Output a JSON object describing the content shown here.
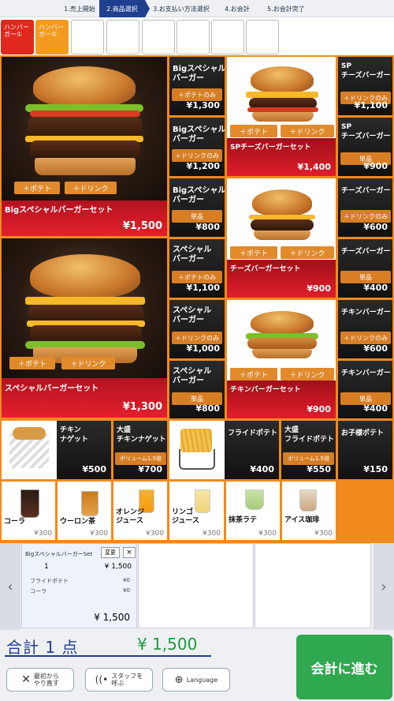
{
  "steps": [
    "1.売上開始",
    "2.商品選択",
    "3.お支払い方法選択",
    "4.お会計",
    "5.お会計完了"
  ],
  "tabs": [
    {
      "label": "ハンバーガー①"
    },
    {
      "label": "ハンバーガー②"
    }
  ],
  "set_buttons": {
    "potato": "＋ポテト",
    "drink": "＋ドリンク",
    "potato_only": "＋ポテトのみ",
    "drink_only": "＋ドリンクのみ",
    "single": "単品",
    "volume": "ボリューム1.5倍"
  },
  "sets": [
    {
      "name": "Bigスペシャルバーガーセット",
      "price": "¥1,500"
    },
    {
      "name": "スペシャルバーガーセット",
      "price": "¥1,300"
    },
    {
      "name": "SPチーズバーガーセット",
      "price": "¥1,400"
    },
    {
      "name": "チーズバーガーセット",
      "price": "¥900"
    },
    {
      "name": "チキンバーガーセット",
      "price": "¥900"
    }
  ],
  "col1": [
    {
      "name": "Bigスペシャル\nバーガー",
      "price": "¥1,300"
    },
    {
      "name": "Bigスペシャル\nバーガー",
      "price": "¥1,200"
    },
    {
      "name": "Bigスペシャル\nバーガー",
      "price": "¥800"
    },
    {
      "name": "スペシャル\nバーガー",
      "price": "¥1,100"
    },
    {
      "name": "スペシャル\nバーガー",
      "price": "¥1,000"
    },
    {
      "name": "スペシャル\nバーガー",
      "price": "¥800"
    }
  ],
  "col2": [
    {
      "name": "SP\nチーズバーガー",
      "price": "¥1,100"
    },
    {
      "name": "SP\nチーズバーガー",
      "price": "¥900"
    },
    {
      "name": "チーズバーガー",
      "price": "¥600"
    },
    {
      "name": "チーズバーガー",
      "price": "¥400"
    },
    {
      "name": "チキンバーガー",
      "price": "¥600"
    },
    {
      "name": "チキンバーガー",
      "price": "¥400"
    }
  ],
  "sides": [
    {
      "name": "チキン\nナゲット",
      "price": "¥500"
    },
    {
      "name": "大盛\nチキンナゲット",
      "price": "¥700"
    },
    {
      "name": "フライドポテト",
      "price": "¥400"
    },
    {
      "name": "大盛\nフライドポテト",
      "price": "¥550"
    },
    {
      "name": "お子様ポテト",
      "price": "¥150"
    }
  ],
  "drinks": [
    {
      "name": "コーラ",
      "price": "¥300"
    },
    {
      "name": "ウーロン茶",
      "price": "¥300"
    },
    {
      "name": "オレンジ\nジュース",
      "price": "¥300"
    },
    {
      "name": "リンゴ\nジュース",
      "price": "¥300"
    },
    {
      "name": "抹茶ラテ",
      "price": "¥300"
    },
    {
      "name": "アイス珈琲",
      "price": "¥300"
    }
  ],
  "cart": {
    "item_name": "BigスペシャルバーガーSet",
    "change": "変更",
    "qty": "1",
    "item_price": "¥ 1,500",
    "sub1": "フライドポテト",
    "sub1_price": "¥0",
    "sub2": "コーラ",
    "sub2_price": "¥0",
    "line_total": "¥ 1,500"
  },
  "total": {
    "label": "合計 1 点",
    "amount": "¥ 1,500",
    "checkout": "会計に進む"
  },
  "footer": {
    "restart": "最初から\nやり直す",
    "staff": "スタッフを\n呼ぶ",
    "language": "Language"
  },
  "colors": {
    "accent": "#f08a1e",
    "set_band": "#e01d2b",
    "checkout": "#2fa84f",
    "total_text": "#1f3f8f"
  }
}
